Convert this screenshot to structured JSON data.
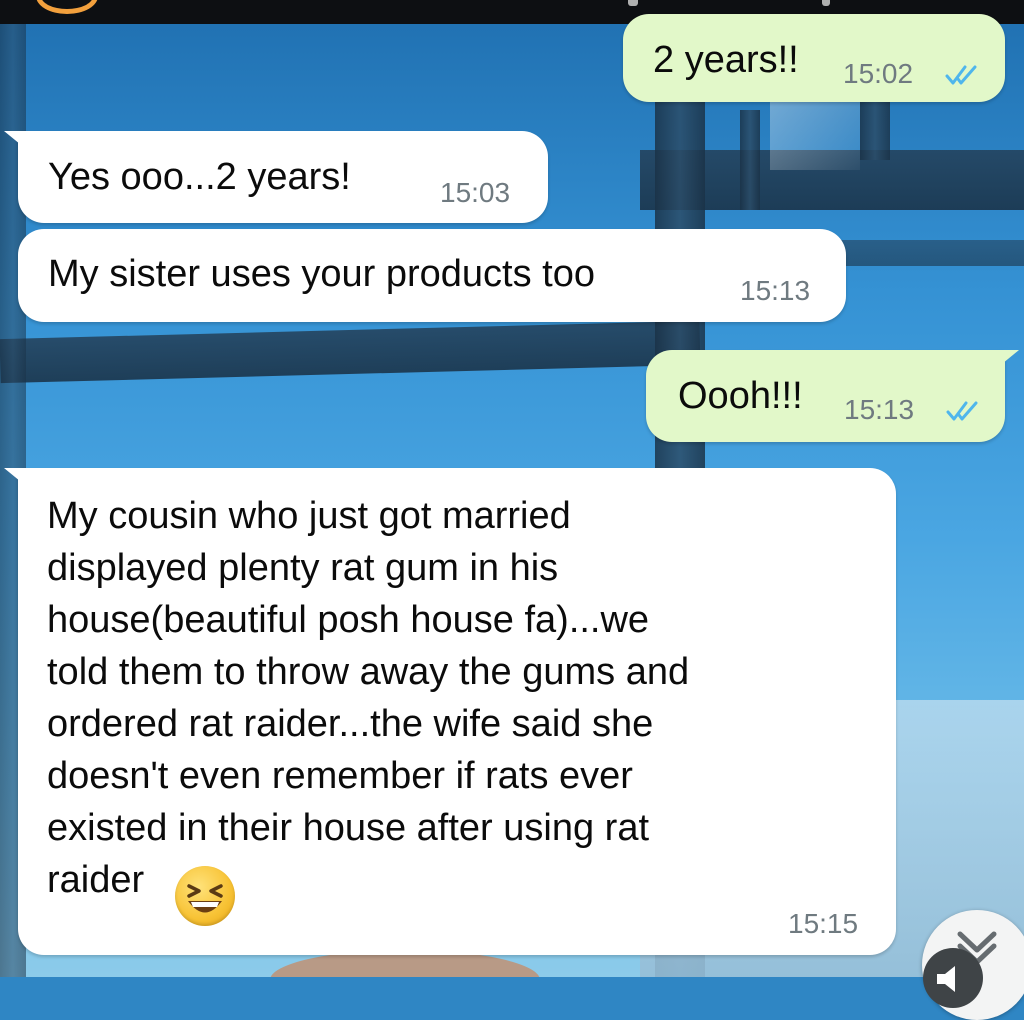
{
  "theme": {
    "outgoing_bubble": "#e2f8c9",
    "incoming_bubble": "#ffffff",
    "time_color": "#6f7a80",
    "read_ticks": "#4fb6ec"
  },
  "messages": [
    {
      "direction": "outgoing",
      "text": "2 years!!",
      "time": "15:02",
      "status": "read"
    },
    {
      "direction": "incoming",
      "text": "Yes ooo...2 years!",
      "time": "15:03"
    },
    {
      "direction": "incoming",
      "text": "My sister uses your products too",
      "time": "15:13"
    },
    {
      "direction": "outgoing",
      "text": "Oooh!!!",
      "time": "15:13",
      "status": "read"
    },
    {
      "direction": "incoming",
      "text": "My cousin who just got married\ndisplayed plenty rat gum in his\nhouse(beautiful posh house fa)...we\ntold them to throw away the gums and\nordered rat raider...the wife said she\ndoesn't even remember if rats ever\nexisted in their house after using  rat\nraider",
      "emoji": "grinning-squinting-face",
      "time": "15:15"
    }
  ],
  "icons": {
    "read_receipt": "double-check-icon",
    "scroll": "scroll-down-button",
    "speaker": "speaker-icon"
  }
}
